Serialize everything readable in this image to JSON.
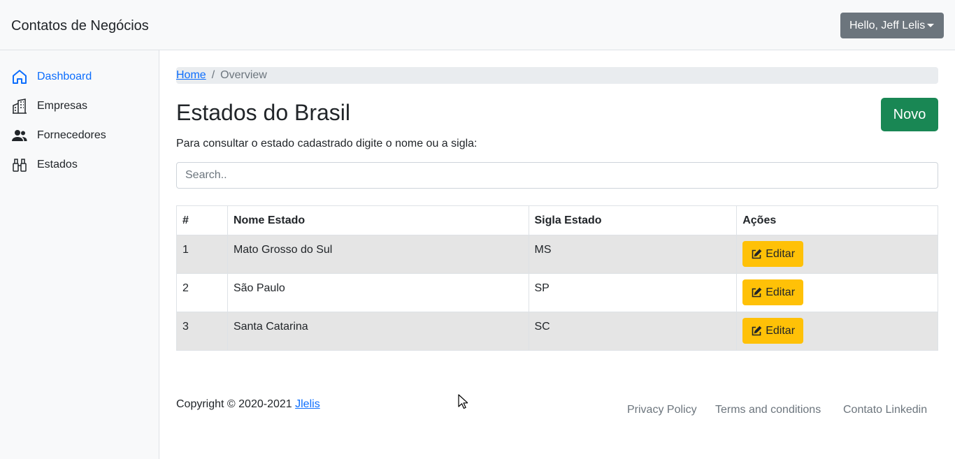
{
  "header": {
    "brand": "Contatos de Negócios",
    "user_menu": "Hello, Jeff Lelis"
  },
  "sidebar": {
    "items": [
      {
        "label": "Dashboard",
        "icon": "home-icon",
        "active": true
      },
      {
        "label": "Empresas",
        "icon": "building-icon"
      },
      {
        "label": "Fornecedores",
        "icon": "people-icon"
      },
      {
        "label": "Estados",
        "icon": "binoculars-icon"
      }
    ]
  },
  "breadcrumb": {
    "home": "Home",
    "current": "Overview"
  },
  "main": {
    "title": "Estados do Brasil",
    "new_button": "Novo",
    "subtitle": "Para consultar o estado cadastrado digite o nome ou a sigla:",
    "search_placeholder": "Search.."
  },
  "table": {
    "headers": [
      "#",
      "Nome Estado",
      "Sigla Estado",
      "Ações"
    ],
    "rows": [
      {
        "id": "1",
        "nome": "Mato Grosso do Sul",
        "sigla": "MS",
        "action": "Editar"
      },
      {
        "id": "2",
        "nome": "São Paulo",
        "sigla": "SP",
        "action": "Editar"
      },
      {
        "id": "3",
        "nome": "Santa Catarina",
        "sigla": "SC",
        "action": "Editar"
      }
    ]
  },
  "footer": {
    "copyright": "Copyright © 2020-2021",
    "copyright_link": "Jlelis",
    "links": [
      "Privacy Policy",
      "Terms and conditions",
      "Contato Linkedin"
    ]
  },
  "colors": {
    "primary": "#0d6efd",
    "success": "#198754",
    "warning": "#ffc107",
    "secondary": "#6c757d"
  }
}
